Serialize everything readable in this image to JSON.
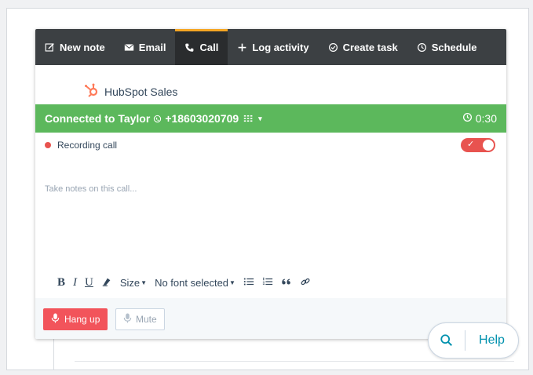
{
  "toolbar": {
    "tabs": [
      {
        "label": "New note",
        "icon": "edit-icon"
      },
      {
        "label": "Email",
        "icon": "envelope-icon"
      },
      {
        "label": "Call",
        "icon": "phone-icon",
        "active": true
      },
      {
        "label": "Log activity",
        "icon": "plus-icon"
      },
      {
        "label": "Create task",
        "icon": "check-circle-icon"
      },
      {
        "label": "Schedule",
        "icon": "clock-icon"
      }
    ]
  },
  "brand": {
    "name": "HubSpot Sales",
    "icon": "hubspot-sprocket-icon",
    "color": "#ff7a59"
  },
  "call": {
    "status": "Connected to Taylor",
    "phone": "+18603020709",
    "timer": "0:30",
    "status_color": "#5cb85c"
  },
  "recording": {
    "label": "Recording call",
    "enabled": true,
    "color": "#e8534f"
  },
  "notes": {
    "placeholder": "Take notes on this call..."
  },
  "editor": {
    "bold": "B",
    "italic": "I",
    "underline": "U",
    "size_label": "Size",
    "font_label": "No font selected"
  },
  "footer": {
    "hang_up": "Hang up",
    "mute": "Mute",
    "hang_up_color": "#f2545b"
  },
  "help": {
    "label": "Help"
  }
}
